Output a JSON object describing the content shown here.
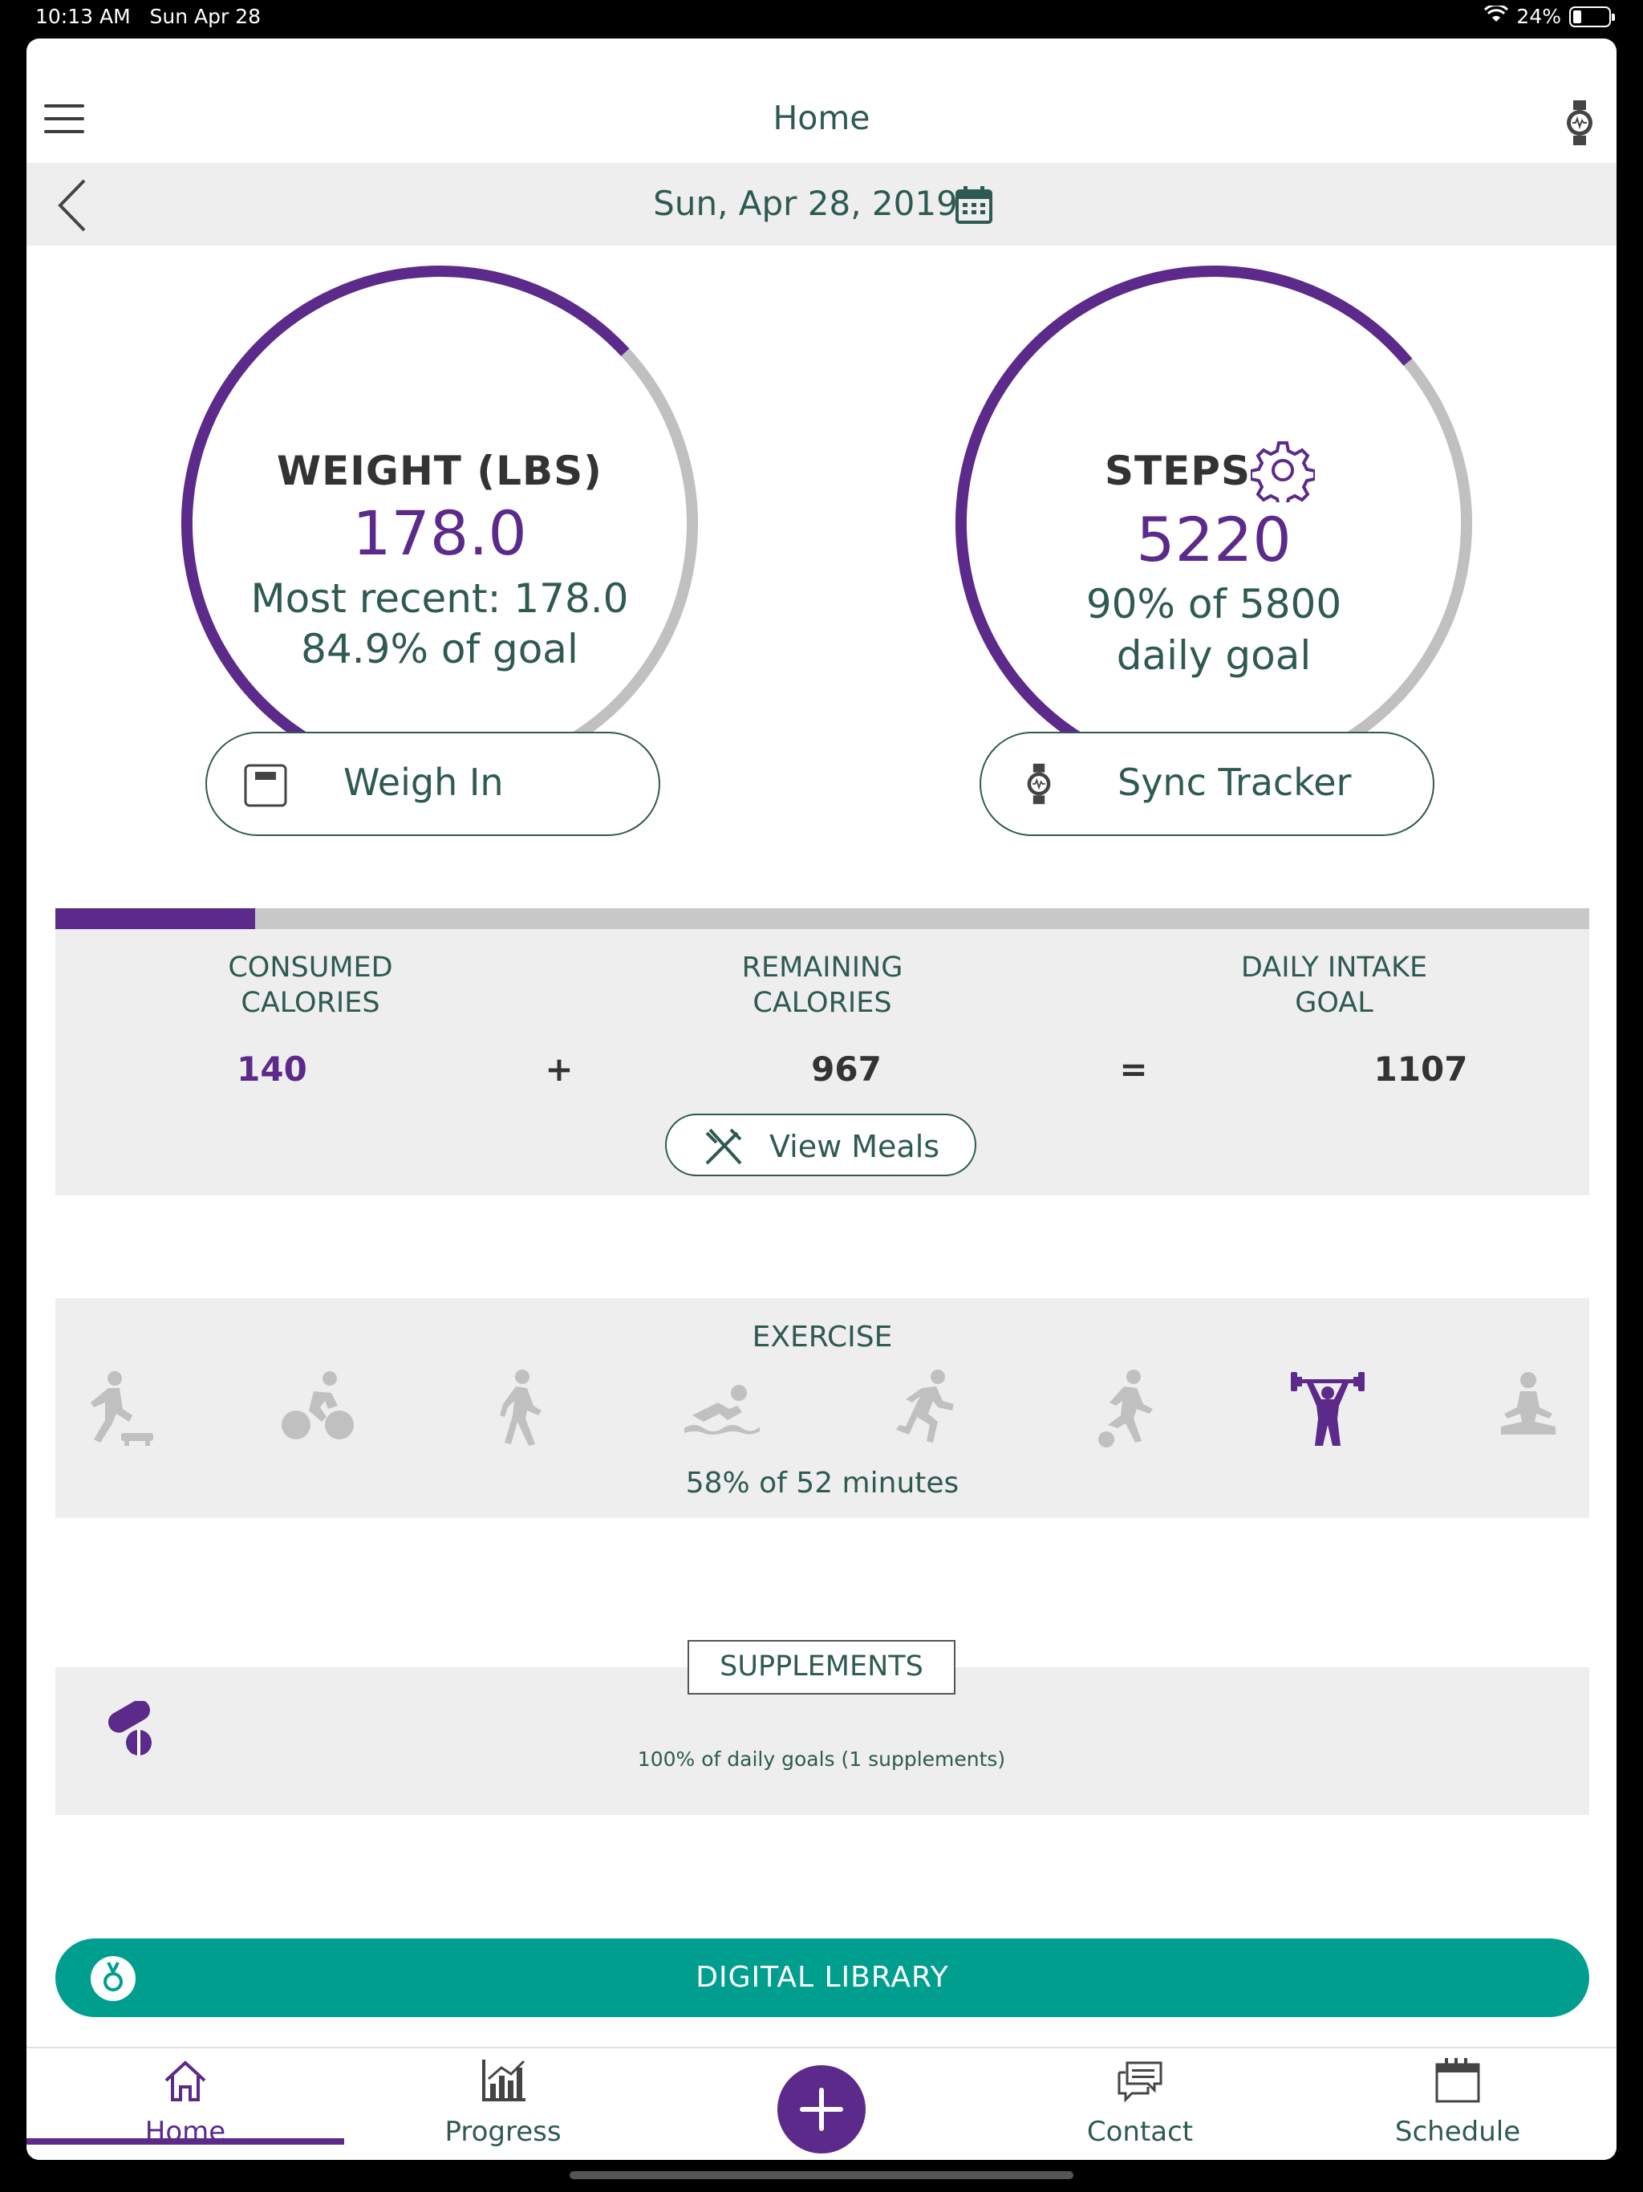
{
  "status_bar": {
    "time": "10:13 AM",
    "date": "Sun Apr 28",
    "battery": "24%"
  },
  "nav": {
    "title": "Home"
  },
  "date_bar": {
    "date": "Sun, Apr 28, 2019"
  },
  "weight": {
    "title": "WEIGHT (LBS)",
    "value": "178.0",
    "recent": "Most recent: 178.0",
    "goal": "84.9% of goal",
    "progress": 0.849,
    "button": "Weigh In"
  },
  "steps": {
    "title": "STEPS",
    "value": "5220",
    "goal_line1": "90% of 5800",
    "goal_line2": "daily goal",
    "progress": 0.9,
    "button": "Sync Tracker"
  },
  "calories": {
    "progress": 0.13,
    "consumed_label_1": "CONSUMED",
    "consumed_label_2": "CALORIES",
    "remaining_label_1": "REMAINING",
    "remaining_label_2": "CALORIES",
    "goal_label_1": "DAILY INTAKE",
    "goal_label_2": "GOAL",
    "consumed": "140",
    "plus": "+",
    "remaining": "967",
    "equals": "=",
    "goal": "1107",
    "view_meals": "View Meals"
  },
  "exercise": {
    "title": "EXERCISE",
    "icons": [
      "step-aerobics-icon",
      "cycling-icon",
      "walking-icon",
      "swimming-icon",
      "running-icon",
      "soccer-icon",
      "weightlifting-icon",
      "yoga-icon"
    ],
    "active_icon": "weightlifting-icon",
    "summary": "58% of 52 minutes"
  },
  "supplements": {
    "title": "SUPPLEMENTS",
    "summary": "100% of daily goals (1 supplements)"
  },
  "digital_library": {
    "label": "DIGITAL LIBRARY"
  },
  "tabs": [
    {
      "label": "Home"
    },
    {
      "label": "Progress"
    },
    {
      "label": "Contact"
    },
    {
      "label": "Schedule"
    }
  ],
  "colors": {
    "accent": "#5c2a8a",
    "teal": "#009e8f",
    "text": "#2e5a52",
    "inactive": "#c0c0c0"
  }
}
